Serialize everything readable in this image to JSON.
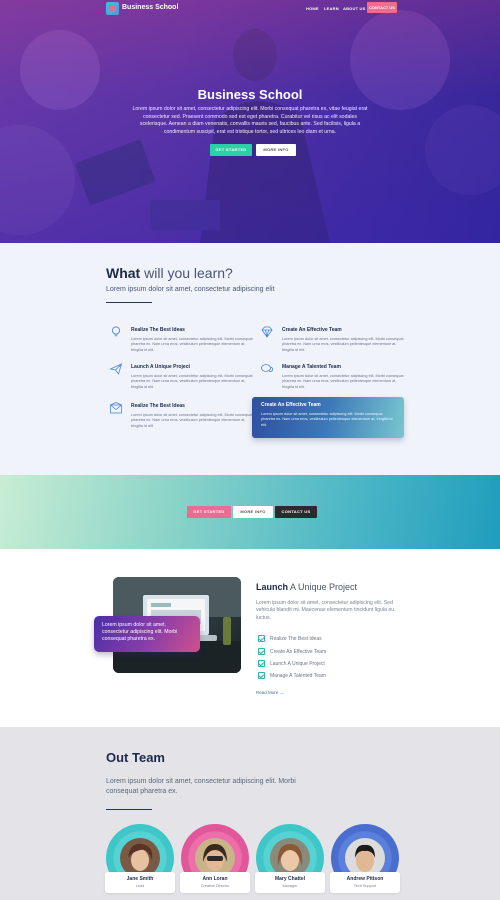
{
  "nav": {
    "brand": "Business School",
    "links": [
      "HOME",
      "LEARN",
      "ABOUT US"
    ],
    "contact": "CONTACT US"
  },
  "hero": {
    "title": "Business School",
    "text": "Lorem ipsum dolor sit amet, consectetur adipiscing elit. Morbi consequat pharetra ex, vitae feugiat erat consectetur sed. Praesent commodo sed est eget pharetra. Curabitur vel risus ac elit sodales scelerisque. Aenean a diam venenatis, convallis mauris sed, faucibus ante. Sed facilisis, ligula a condimentum suscipit, erat est tristique tortor, sed ultrices leo diam et urna.",
    "btn_primary": "GET STARTED",
    "btn_secondary": "MORE INFO"
  },
  "learn": {
    "heading_bold": "What",
    "heading_rest": " will you learn?",
    "subtitle": "Lorem ipsum dolor sit amet, consectetur adipiscing elit",
    "features": [
      {
        "title": "Realize The Best Ideas",
        "desc": "Lorem ipsum dolor sit amet, consectetur adipiscing elit. Morbi consequat pharetra ex. Nam urna eros, vestibulum pellentesque elementum at, fringilla id elit.",
        "icon": "lightbulb-icon"
      },
      {
        "title": "Create An Effective Team",
        "desc": "Lorem ipsum dolor sit amet, consectetur adipiscing elit. Morbi consequat pharetra ex. Nam urna eros, vestibulum pellentesque elementum at, fringilla id elit.",
        "icon": "diamond-icon"
      },
      {
        "title": "Launch A Unique Project",
        "desc": "Lorem ipsum dolor sit amet, consectetur adipiscing elit. Morbi consequat pharetra ex. Nam urna eros, vestibulum pellentesque elementum at, fringilla id elit.",
        "icon": "paper-plane-icon"
      },
      {
        "title": "Manage A Talented Team",
        "desc": "Lorem ipsum dolor sit amet, consectetur adipiscing elit. Morbi consequat pharetra ex. Nam urna eros, vestibulum pellentesque elementum at, fringilla id elit.",
        "icon": "chat-bubbles-icon"
      },
      {
        "title": "Realize The Best Ideas",
        "desc": "Lorem ipsum dolor sit amet, consectetur adipiscing elit. Morbi consequat pharetra ex. Nam urna eros, vestibulum pellentesque elementum at, fringilla id elit.",
        "icon": "envelope-icon"
      },
      {
        "title": "Create An Effective Team",
        "desc": "Lorem ipsum dolor sit amet, consectetur adipiscing elit. Morbi consequat pharetra ex. Nam urna eros, vestibulum pellentesque elementum at, fringilla id elit.",
        "icon": ""
      }
    ]
  },
  "cta": {
    "btn1": "GET STARTED",
    "btn2": "MORE INFO",
    "btn3": "CONTACT US"
  },
  "project": {
    "quote": "Lorem ipsum dolor sit amet, consectetur adipiscing elit. Morbi consequat pharetra ex.",
    "title_bold": "Launch",
    "title_rest": " A Unique Project",
    "text": "Lorem ipsum dolor sit amet, consectetur adipiscing elit. Sed vehicula blandit mi. Maecenas elementum tincidunt ligula eu luctus.",
    "checklist": [
      "Realize The Best Ideas",
      "Create An Effective Team",
      "Launch A Unique Project",
      "Manage A Talented Team"
    ],
    "read_more": "Read More →"
  },
  "team": {
    "heading": "Out Team",
    "text": "Lorem ipsum dolor sit amet, consectetur adipiscing elit. Morbi consequat pharetra ex.",
    "members": [
      {
        "name": "Jane Smith",
        "role": "Lead",
        "ring": "#3fc6c8"
      },
      {
        "name": "Ann Loran",
        "role": "Creative Director",
        "ring": "#e2579a"
      },
      {
        "name": "Mary Chattel",
        "role": "Manager",
        "ring": "#3fc6c8"
      },
      {
        "name": "Andrew Pittson",
        "role": "Tech Support",
        "ring": "#4a6ed0"
      }
    ]
  },
  "colors": {
    "accent_green": "#2bd1a6",
    "accent_pink": "#ee6c93",
    "navy": "#1c2a48"
  }
}
